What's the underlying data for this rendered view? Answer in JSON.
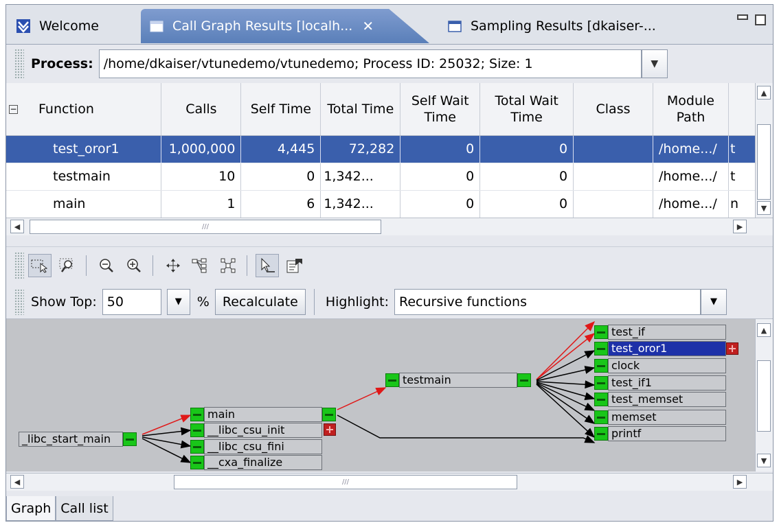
{
  "tabs": [
    {
      "label": "Welcome"
    },
    {
      "label": "Call Graph Results [localh...",
      "close": "✕"
    },
    {
      "label": "Sampling Results [dkaiser-..."
    }
  ],
  "process": {
    "label": "Process:",
    "value": "/home/dkaiser/vtunedemo/vtunedemo; Process ID: 25032; Size: 1"
  },
  "table": {
    "collapse_glyph": "−",
    "columns": [
      "Function",
      "Calls",
      "Self Time",
      "Total Time",
      "Self Wait Time",
      "Total Wait Time",
      "Class",
      "Module Path",
      ""
    ],
    "rows": [
      {
        "function": "test_oror1",
        "calls": "1,000,000",
        "self_time": "4,445",
        "total_time": "72,282",
        "self_wait": "0",
        "total_wait": "0",
        "class": "",
        "module": "/home.../",
        "extra": "t",
        "selected": true
      },
      {
        "function": "testmain",
        "calls": "10",
        "self_time": "0",
        "total_time": "1,342...",
        "self_wait": "0",
        "total_wait": "0",
        "class": "",
        "module": "/home.../",
        "extra": "t",
        "selected": false
      },
      {
        "function": "main",
        "calls": "1",
        "self_time": "6",
        "total_time": "1,342...",
        "self_wait": "0",
        "total_wait": "0",
        "class": "",
        "module": "/home.../",
        "extra": "n",
        "selected": false
      }
    ]
  },
  "toolbar": {
    "show_top_label": "Show Top:",
    "show_top_value": "50",
    "percent": "%",
    "recalculate": "Recalculate",
    "highlight_label": "Highlight:",
    "highlight_value": "Recursive functions"
  },
  "graph": {
    "nodes": [
      {
        "label": "_libc_start_main"
      },
      {
        "label": "main"
      },
      {
        "label": "__libc_csu_init"
      },
      {
        "label": "__libc_csu_fini"
      },
      {
        "label": "__cxa_finalize"
      },
      {
        "label": "testmain"
      },
      {
        "label": "test_if"
      },
      {
        "label": "test_oror1"
      },
      {
        "label": "clock"
      },
      {
        "label": "test_if1"
      },
      {
        "label": "test_memset"
      },
      {
        "label": "memset"
      },
      {
        "label": "printf"
      }
    ]
  },
  "bottom_tabs": [
    "Graph",
    "Call list"
  ],
  "colors": {
    "selection": "#3a5fac",
    "graph_selection": "#1d31a8",
    "node_green": "#19c619",
    "node_red": "#c02020",
    "critical_edge": "#e01818"
  }
}
